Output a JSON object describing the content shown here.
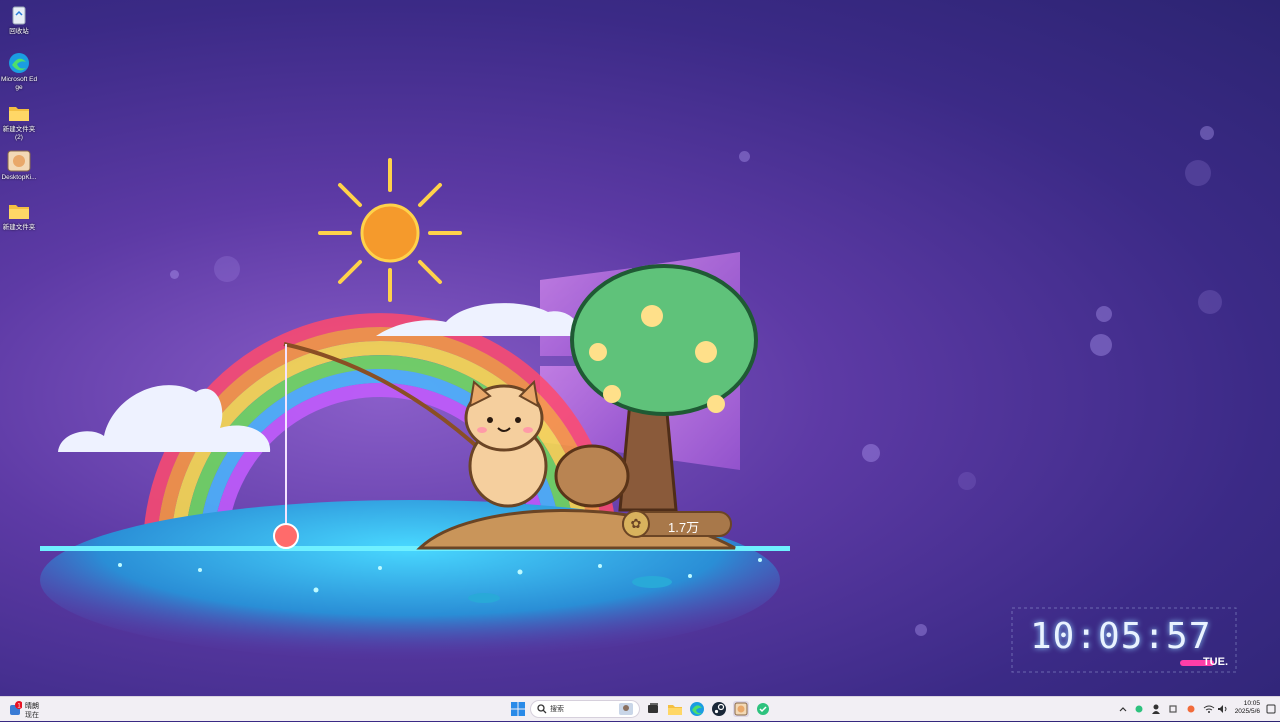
{
  "desktop_icons": [
    {
      "label": "回收站",
      "icon": "recycle-bin-icon"
    },
    {
      "label": "Microsoft Edge",
      "icon": "edge-icon"
    },
    {
      "label": "新建文件夹 (2)",
      "icon": "folder-icon"
    },
    {
      "label": "DesktopKi...",
      "icon": "app-icon"
    },
    {
      "label": "新建文件夹",
      "icon": "folder-icon"
    }
  ],
  "wallpaper": {
    "coin_count": "1.7万"
  },
  "clock": {
    "time": "10:05:57",
    "day": "TUE."
  },
  "taskbar": {
    "weather": {
      "line1": "晴朗",
      "line2": "现在",
      "badge": "1"
    },
    "search_placeholder": "搜索",
    "tray": {
      "time": "10:05",
      "date": "2025/5/6"
    }
  },
  "colors": {
    "accent_pink": "#ff3ea8",
    "water": "#25c8f0",
    "taskbar": "#f2eff4"
  }
}
